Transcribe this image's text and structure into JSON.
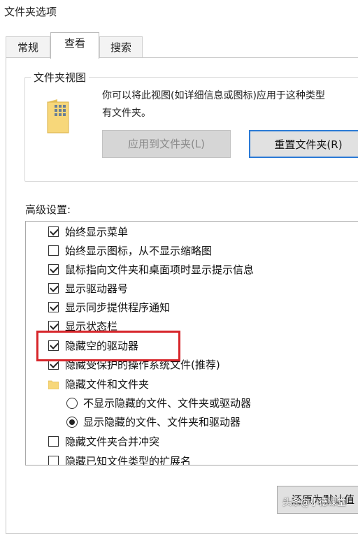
{
  "window": {
    "title": "文件夹选项"
  },
  "tabs": [
    {
      "label": "常规",
      "active": false
    },
    {
      "label": "查看",
      "active": true
    },
    {
      "label": "搜索",
      "active": false
    }
  ],
  "folder_views": {
    "group_label": "文件夹视图",
    "description_line1": "你可以将此视图(如详细信息或图标)应用于这种类型",
    "description_line2": "有文件夹。",
    "apply_button": "应用到文件夹(L)",
    "reset_button": "重置文件夹(R)"
  },
  "advanced": {
    "label": "高级设置:",
    "items": [
      {
        "type": "checkbox",
        "checked": true,
        "label": "始终显示菜单"
      },
      {
        "type": "checkbox",
        "checked": false,
        "label": "始终显示图标，从不显示缩略图"
      },
      {
        "type": "checkbox",
        "checked": true,
        "label": "鼠标指向文件夹和桌面项时显示提示信息"
      },
      {
        "type": "checkbox",
        "checked": true,
        "label": "显示驱动器号"
      },
      {
        "type": "checkbox",
        "checked": true,
        "label": "显示同步提供程序通知"
      },
      {
        "type": "checkbox",
        "checked": true,
        "label": "显示状态栏"
      },
      {
        "type": "checkbox",
        "checked": true,
        "label": "隐藏空的驱动器",
        "highlighted": true
      },
      {
        "type": "checkbox",
        "checked": true,
        "label": "隐藏受保护的操作系统文件(推荐)"
      },
      {
        "type": "folder",
        "label": "隐藏文件和文件夹"
      },
      {
        "type": "radio",
        "checked": false,
        "label": "不显示隐藏的文件、文件夹或驱动器"
      },
      {
        "type": "radio",
        "checked": true,
        "label": "显示隐藏的文件、文件夹和驱动器"
      },
      {
        "type": "checkbox",
        "checked": false,
        "label": "隐藏文件夹合并冲突"
      },
      {
        "type": "checkbox",
        "checked": false,
        "label": "隐藏已知文件类型的扩展名"
      }
    ]
  },
  "footer": {
    "restore_button": "还原为默认值"
  },
  "watermark": "头条@小德课堂",
  "colors": {
    "highlight": "#d7262b",
    "focus": "#2a7ad6",
    "folder": "#f7d77a"
  }
}
